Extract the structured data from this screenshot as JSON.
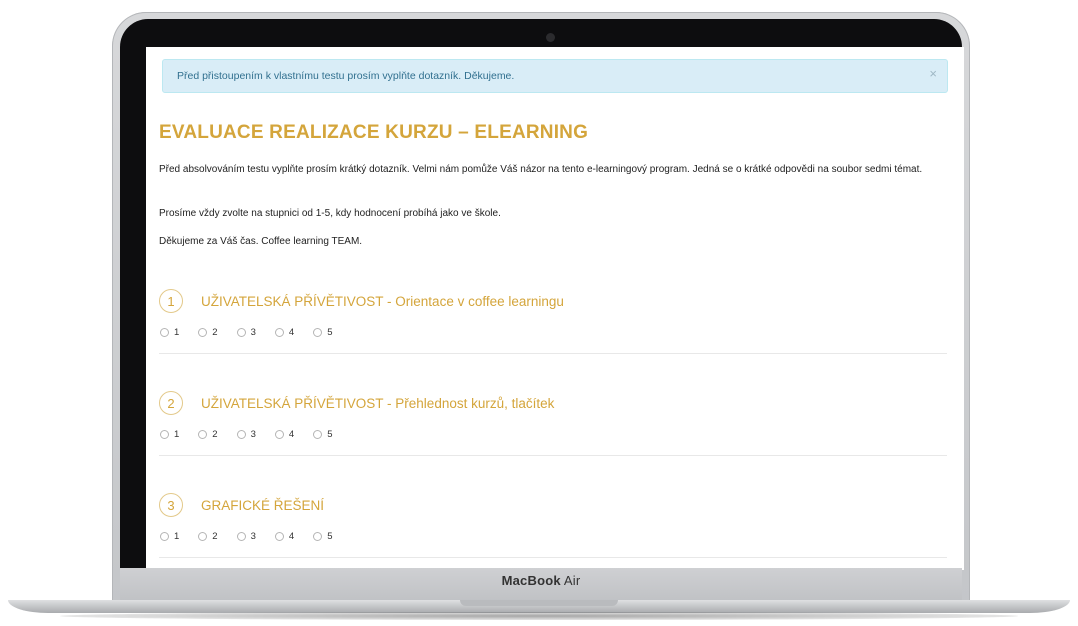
{
  "device": {
    "brand": "MacBook",
    "model": "Air"
  },
  "alert": {
    "text": "Před přistoupením k vlastnímu testu prosím vyplňte dotazník. Děkujeme.",
    "close": "×"
  },
  "page": {
    "title": "EVALUACE REALIZACE KURZU – ELEARNING",
    "intro": [
      "Před absolvováním testu vyplňte prosím krátký dotazník. Velmi nám pomůže Váš názor na tento e-learningový program. Jedná se o krátké odpovědi na soubor sedmi témat.",
      "Prosíme vždy zvolte na stupnici od 1-5, kdy hodnocení probíhá jako ve škole.",
      "Děkujeme za Váš čas. Coffee learning TEAM."
    ]
  },
  "questions": [
    {
      "number": "1",
      "title": "UŽIVATELSKÁ PŘÍVĚTIVOST - Orientace v coffee learningu",
      "options": [
        "1",
        "2",
        "3",
        "4",
        "5"
      ]
    },
    {
      "number": "2",
      "title": "UŽIVATELSKÁ PŘÍVĚTIVOST - Přehlednost kurzů, tlačítek",
      "options": [
        "1",
        "2",
        "3",
        "4",
        "5"
      ]
    },
    {
      "number": "3",
      "title": "GRAFICKÉ ŘEŠENÍ",
      "options": [
        "1",
        "2",
        "3",
        "4",
        "5"
      ]
    }
  ]
}
